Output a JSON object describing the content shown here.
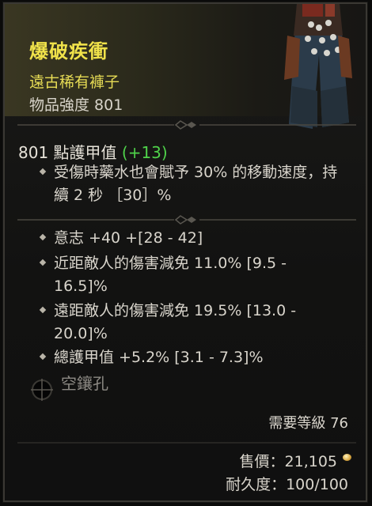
{
  "item": {
    "name": "爆破疾衝",
    "rarity": "遠古稀有褲子",
    "power": "物品強度 801",
    "armor_value": "801 點護甲值",
    "armor_delta": "(+13)"
  },
  "affixes": {
    "implicit": "受傷時藥水也會賦予 30% 的移動速度，持續 2 秒 ［30］%",
    "stats": [
      "意志 +40 +[28 - 42]",
      "近距敵人的傷害減免 11.0% [9.5 - 16.5]%",
      "遠距敵人的傷害減免 19.5% [13.0 - 20.0]%",
      "總護甲值 +5.2% [3.1 - 7.3]%"
    ]
  },
  "socket": {
    "label": "空鑲孔",
    "icon": "empty-socket-icon"
  },
  "footer": {
    "requirement": "需要等級 76",
    "price": "售價：21,105",
    "durability": "耐久度：100/100",
    "gold_icon": "gold-coin-icon"
  },
  "colors": {
    "title": "#f0e24a",
    "rarity": "#e7dc55",
    "delta": "#4fd24a",
    "socket_text": "#8d8a84"
  }
}
